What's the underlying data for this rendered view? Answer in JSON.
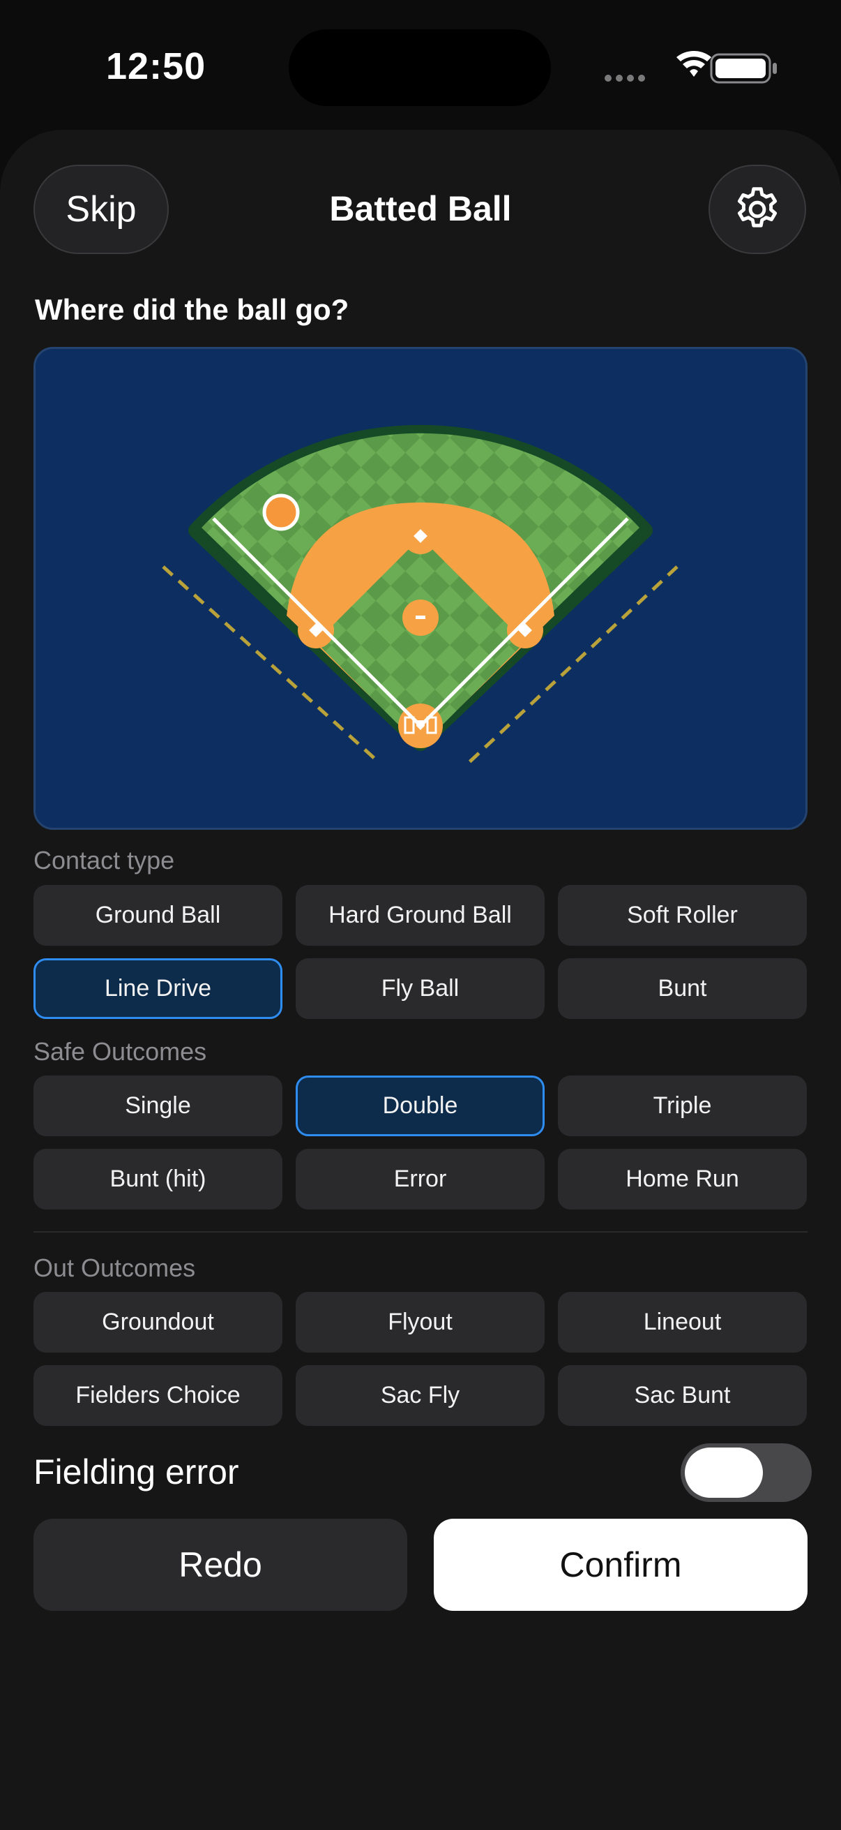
{
  "status_bar": {
    "time": "12:50",
    "icons": [
      "signal-dots-icon",
      "wifi-icon",
      "battery-icon"
    ]
  },
  "header": {
    "skip_label": "Skip",
    "title": "Batted Ball",
    "settings_icon": "gear-icon"
  },
  "question": "Where did the ball go?",
  "field": {
    "ball_marker_color": "#f5973a",
    "grass_color": "#5d9f4b",
    "infield_color": "#f6a244",
    "background_color": "#0c2e61"
  },
  "contact_type": {
    "label": "Contact type",
    "options": [
      "Ground Ball",
      "Hard Ground Ball",
      "Soft Roller",
      "Line Drive",
      "Fly Ball",
      "Bunt"
    ],
    "selected": "Line Drive"
  },
  "safe_outcomes": {
    "label": "Safe Outcomes",
    "options": [
      "Single",
      "Double",
      "Triple",
      "Bunt (hit)",
      "Error",
      "Home Run"
    ],
    "selected": "Double"
  },
  "out_outcomes": {
    "label": "Out Outcomes",
    "options": [
      "Groundout",
      "Flyout",
      "Lineout",
      "Fielders Choice",
      "Sac Fly",
      "Sac Bunt"
    ],
    "selected": ""
  },
  "fielding_error": {
    "label": "Fielding error",
    "on": false
  },
  "actions": {
    "redo_label": "Redo",
    "confirm_label": "Confirm"
  },
  "colors": {
    "accent": "#2f8cf0",
    "selected_bg": "#0d2b4a"
  }
}
